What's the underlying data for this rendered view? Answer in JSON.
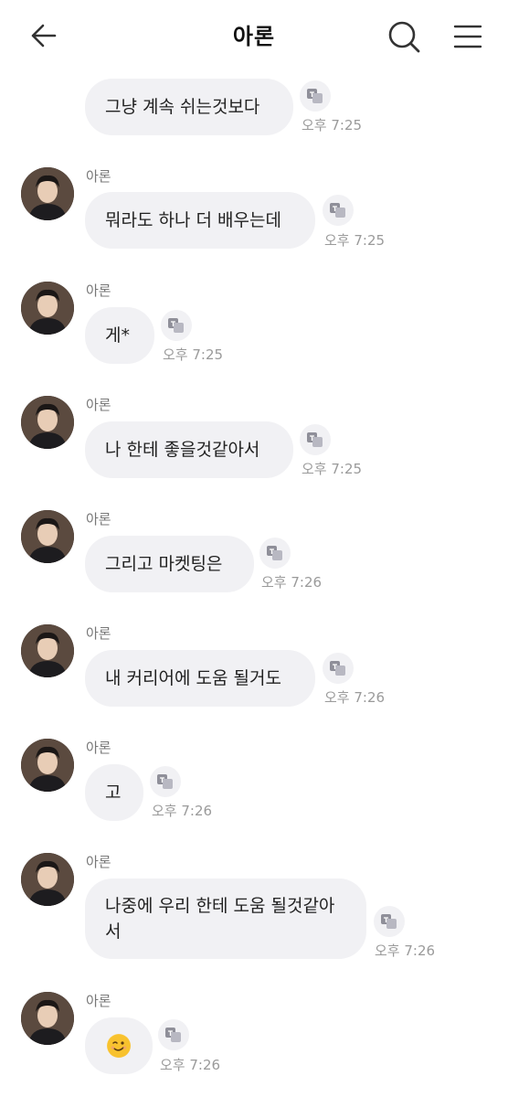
{
  "header": {
    "title": "아론",
    "back_icon": "arrow-left-icon",
    "search_icon": "search-icon",
    "menu_icon": "menu-icon"
  },
  "messages": [
    {
      "sender": "",
      "text": "그냥 계속 쉬는것보다",
      "time": "오후 7:25",
      "show_avatar": false
    },
    {
      "sender": "아론",
      "text": "뭐라도 하나 더 배우는데",
      "time": "오후 7:25",
      "show_avatar": true
    },
    {
      "sender": "아론",
      "text": "게*",
      "time": "오후 7:25",
      "show_avatar": true
    },
    {
      "sender": "아론",
      "text": "나 한테 좋을것같아서",
      "time": "오후 7:25",
      "show_avatar": true
    },
    {
      "sender": "아론",
      "text": "그리고 마켓팅은",
      "time": "오후 7:26",
      "show_avatar": true
    },
    {
      "sender": "아론",
      "text": "내 커리어에 도움 될거도",
      "time": "오후 7:26",
      "show_avatar": true
    },
    {
      "sender": "아론",
      "text": "고",
      "time": "오후 7:26",
      "show_avatar": true
    },
    {
      "sender": "아론",
      "text": "나중에 우리 한테 도움 될것같아서",
      "time": "오후 7:26",
      "show_avatar": true
    },
    {
      "sender": "아론",
      "text": "",
      "emoji": "wink-emoji",
      "time": "오후 7:26",
      "show_avatar": true
    }
  ],
  "colors": {
    "bubble": "#f1f1f4",
    "time": "#9a9a9a",
    "sender": "#777777"
  }
}
